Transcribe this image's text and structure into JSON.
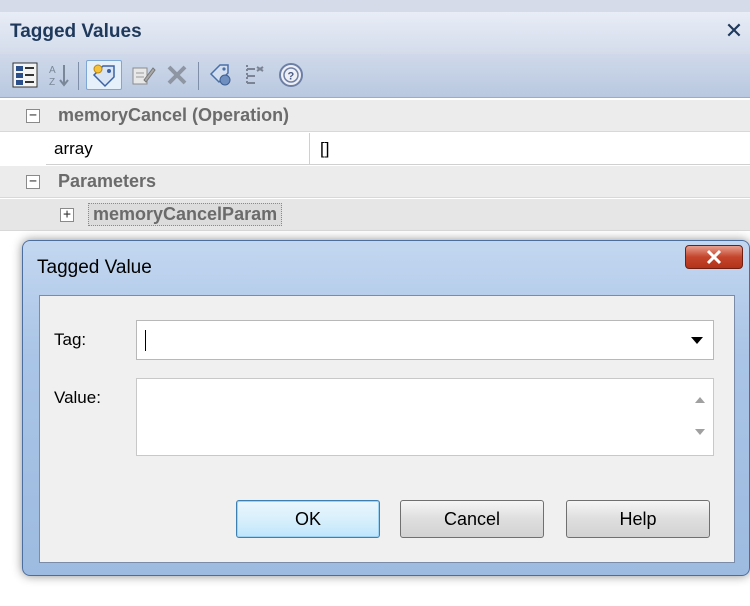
{
  "panel": {
    "title": "Tagged Values",
    "close_glyph": "✕",
    "toolbar": [
      {
        "name": "categorized-view-icon"
      },
      {
        "name": "alphabetical-sort-icon"
      },
      {
        "name": "new-tag-icon"
      },
      {
        "name": "edit-tag-icon"
      },
      {
        "name": "delete-tag-icon"
      },
      {
        "name": "tag-notes-icon"
      },
      {
        "name": "show-inherited-icon"
      },
      {
        "name": "help-icon"
      }
    ]
  },
  "grid": {
    "operation_header": "memoryCancel (Operation)",
    "properties": [
      {
        "name": "array",
        "value": "[]"
      }
    ],
    "parameters_header": "Parameters",
    "parameter_item": "memoryCancelParam",
    "collapse_glyph": "−",
    "expand_glyph": "+"
  },
  "dialog": {
    "title": "Tagged Value",
    "close_glyph": "X",
    "tag_label": "Tag:",
    "tag_value": "",
    "value_label": "Value:",
    "value_text": "",
    "buttons": {
      "ok": "OK",
      "cancel": "Cancel",
      "help": "Help"
    }
  },
  "colors": {
    "title_text": "#1e395b",
    "dialog_frame": "#9dbbe0",
    "close_button": "#c4452d"
  }
}
